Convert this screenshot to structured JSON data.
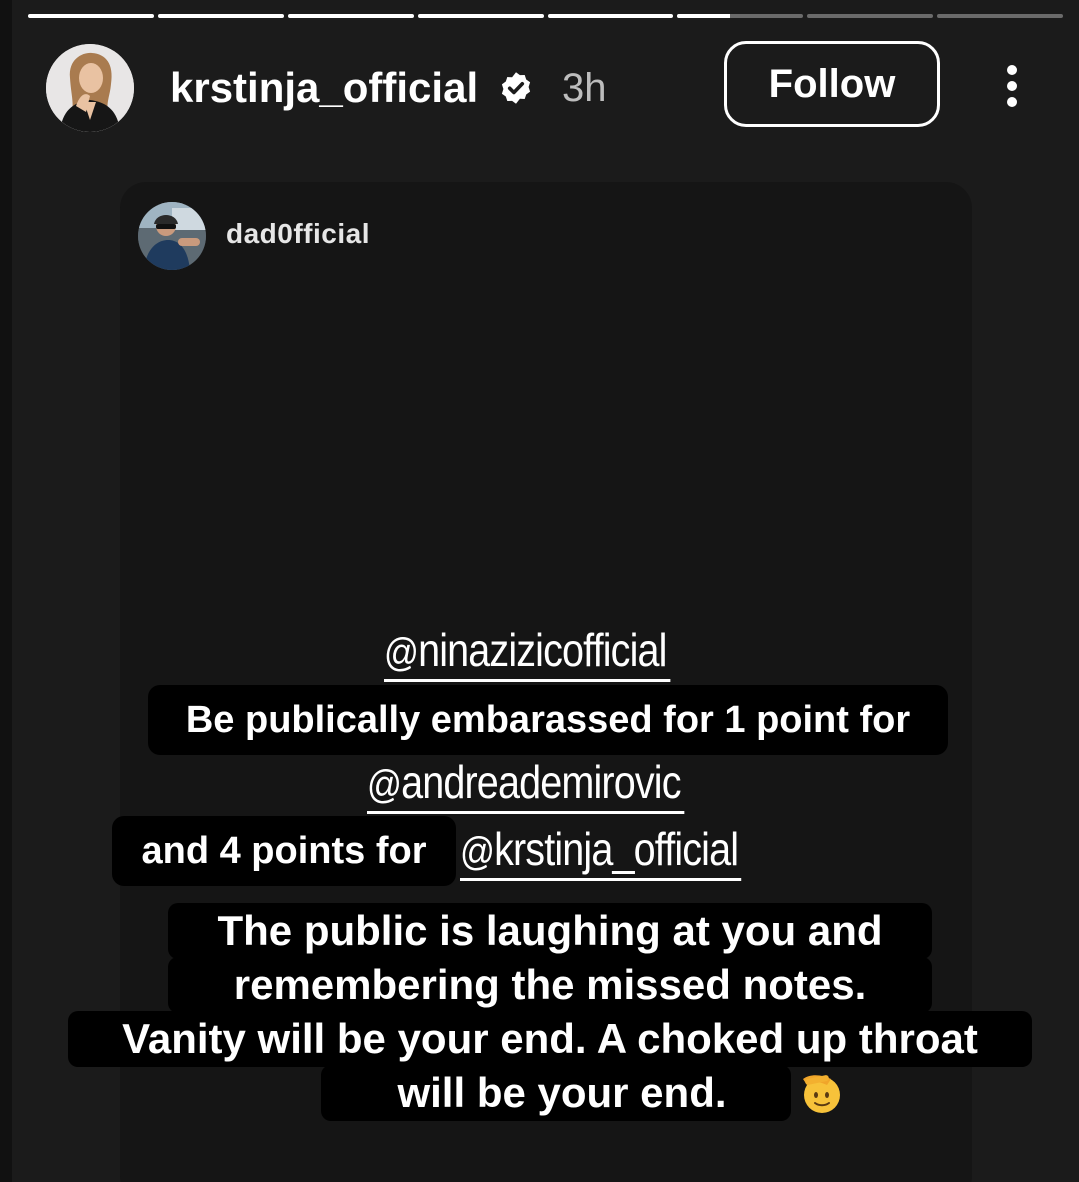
{
  "story": {
    "progress": [
      1,
      1,
      1,
      1,
      1,
      0.42,
      0,
      0
    ],
    "header": {
      "username": "krstinja_official",
      "time": "3h",
      "follow_label": "Follow",
      "verified_icon": "verified-badge-icon",
      "more_icon": "more-vertical-icon"
    },
    "shared_post": {
      "username": "dad0fficial"
    },
    "mentions": {
      "m1": "ninazizicofficial",
      "m2": "andreademirovic",
      "m3": "krstinja_official"
    },
    "captions": {
      "c1": "Be publically embarassed for 1 point for",
      "c2": "and 4 points for",
      "c3_l1": "The public is laughing at you and",
      "c3_l2": "remembering the missed notes.",
      "c3_l3": "Vanity will be your end. A choked up throat",
      "c3_l4": "will be your end."
    },
    "emoji": "saluting-face-emoji"
  }
}
